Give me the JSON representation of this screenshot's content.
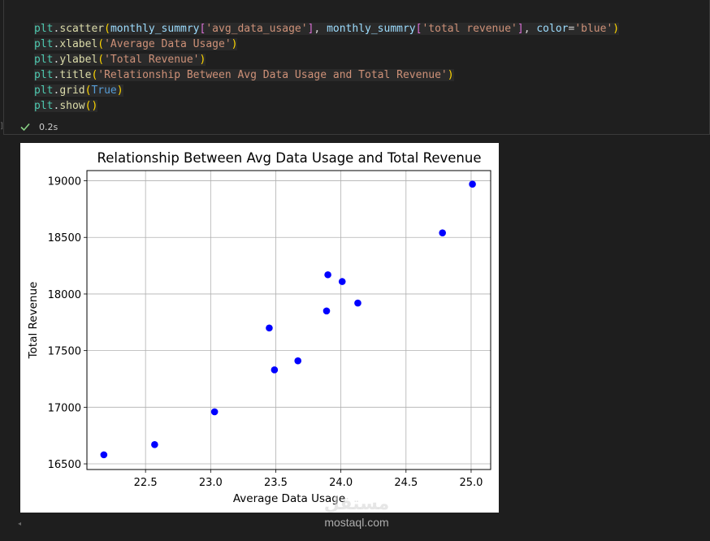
{
  "code": {
    "lines": [
      {
        "tokens": [
          {
            "t": "plt",
            "c": "tok-obj"
          },
          {
            "t": ".",
            "c": "tok-punc"
          },
          {
            "t": "scatter",
            "c": "tok-fn"
          },
          {
            "t": "(",
            "c": "tok-paren"
          },
          {
            "t": "monthly_summry",
            "c": "tok-var"
          },
          {
            "t": "[",
            "c": "tok-brack"
          },
          {
            "t": "'avg_data_usage'",
            "c": "tok-str"
          },
          {
            "t": "]",
            "c": "tok-brack"
          },
          {
            "t": ", ",
            "c": "tok-punc"
          },
          {
            "t": "monthly_summry",
            "c": "tok-var"
          },
          {
            "t": "[",
            "c": "tok-brack"
          },
          {
            "t": "'total revenue'",
            "c": "tok-str"
          },
          {
            "t": "]",
            "c": "tok-brack"
          },
          {
            "t": ", ",
            "c": "tok-punc"
          },
          {
            "t": "color",
            "c": "tok-var"
          },
          {
            "t": "=",
            "c": "tok-punc"
          },
          {
            "t": "'blue'",
            "c": "tok-str"
          },
          {
            "t": ")",
            "c": "tok-paren"
          }
        ]
      },
      {
        "tokens": [
          {
            "t": "plt",
            "c": "tok-obj"
          },
          {
            "t": ".",
            "c": "tok-punc"
          },
          {
            "t": "xlabel",
            "c": "tok-fn"
          },
          {
            "t": "(",
            "c": "tok-paren"
          },
          {
            "t": "'Average Data Usage'",
            "c": "tok-str"
          },
          {
            "t": ")",
            "c": "tok-paren"
          }
        ]
      },
      {
        "tokens": [
          {
            "t": "plt",
            "c": "tok-obj"
          },
          {
            "t": ".",
            "c": "tok-punc"
          },
          {
            "t": "ylabel",
            "c": "tok-fn"
          },
          {
            "t": "(",
            "c": "tok-paren"
          },
          {
            "t": "'Total Revenue'",
            "c": "tok-str"
          },
          {
            "t": ")",
            "c": "tok-paren"
          }
        ]
      },
      {
        "tokens": [
          {
            "t": "plt",
            "c": "tok-obj"
          },
          {
            "t": ".",
            "c": "tok-punc"
          },
          {
            "t": "title",
            "c": "tok-fn"
          },
          {
            "t": "(",
            "c": "tok-paren"
          },
          {
            "t": "'Relationship Between Avg Data Usage and Total Revenue'",
            "c": "tok-str"
          },
          {
            "t": ")",
            "c": "tok-paren"
          }
        ]
      },
      {
        "tokens": [
          {
            "t": "plt",
            "c": "tok-obj"
          },
          {
            "t": ".",
            "c": "tok-punc"
          },
          {
            "t": "grid",
            "c": "tok-fn"
          },
          {
            "t": "(",
            "c": "tok-paren"
          },
          {
            "t": "True",
            "c": "tok-kw"
          },
          {
            "t": ")",
            "c": "tok-paren"
          }
        ]
      },
      {
        "tokens": [
          {
            "t": "plt",
            "c": "tok-obj"
          },
          {
            "t": ".",
            "c": "tok-punc"
          },
          {
            "t": "show",
            "c": "tok-fn"
          },
          {
            "t": "()",
            "c": "tok-paren"
          }
        ]
      }
    ]
  },
  "status": {
    "icon": "check-icon",
    "time": "0.2s",
    "color": "#89d185"
  },
  "watermark": {
    "logo": "مستقل",
    "text": "mostaql.com"
  },
  "chart_data": {
    "type": "scatter",
    "title": "Relationship Between Avg Data Usage and Total Revenue",
    "xlabel": "Average Data Usage",
    "ylabel": "Total Revenue",
    "xlim": [
      22.05,
      25.15
    ],
    "ylim": [
      16450,
      19090
    ],
    "xticks": [
      22.5,
      23.0,
      23.5,
      24.0,
      24.5,
      25.0
    ],
    "xtick_labels": [
      "22.5",
      "23.0",
      "23.5",
      "24.0",
      "24.5",
      "25.0"
    ],
    "yticks": [
      16500,
      17000,
      17500,
      18000,
      18500,
      19000
    ],
    "ytick_labels": [
      "16500",
      "17000",
      "17500",
      "18000",
      "18500",
      "19000"
    ],
    "grid": true,
    "color": "#0000ff",
    "points": [
      {
        "x": 22.18,
        "y": 16580
      },
      {
        "x": 22.57,
        "y": 16670
      },
      {
        "x": 23.03,
        "y": 16960
      },
      {
        "x": 23.45,
        "y": 17700
      },
      {
        "x": 23.49,
        "y": 17330
      },
      {
        "x": 23.67,
        "y": 17410
      },
      {
        "x": 23.89,
        "y": 17850
      },
      {
        "x": 23.9,
        "y": 18170
      },
      {
        "x": 24.01,
        "y": 18110
      },
      {
        "x": 24.13,
        "y": 17920
      },
      {
        "x": 24.78,
        "y": 18540
      },
      {
        "x": 25.01,
        "y": 18970
      }
    ]
  }
}
